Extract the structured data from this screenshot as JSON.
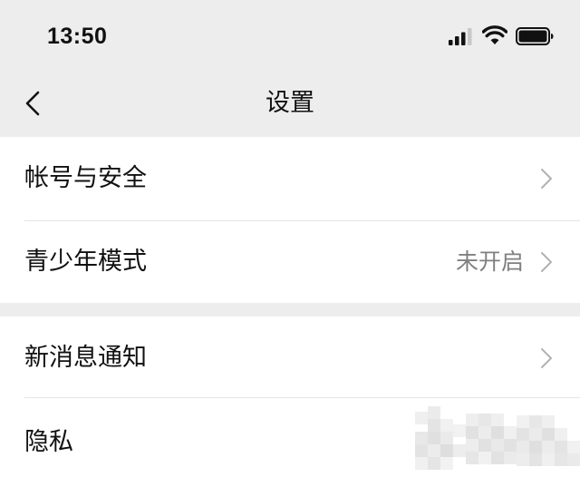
{
  "status_bar": {
    "time": "13:50",
    "icons": [
      "signal-icon",
      "wifi-icon",
      "battery-icon"
    ]
  },
  "nav": {
    "title": "设置",
    "back_icon": "chevron-left-icon"
  },
  "groups": [
    {
      "items": [
        {
          "label": "帐号与安全",
          "value": ""
        },
        {
          "label": "青少年模式",
          "value": "未开启"
        }
      ]
    },
    {
      "items": [
        {
          "label": "新消息通知",
          "value": ""
        },
        {
          "label": "隐私",
          "value": ""
        }
      ]
    }
  ],
  "colors": {
    "background": "#ededed",
    "card": "#ffffff",
    "text": "#111111",
    "secondary_text": "#808080",
    "chevron": "#b2b2b2",
    "divider": "#e5e5e5"
  }
}
